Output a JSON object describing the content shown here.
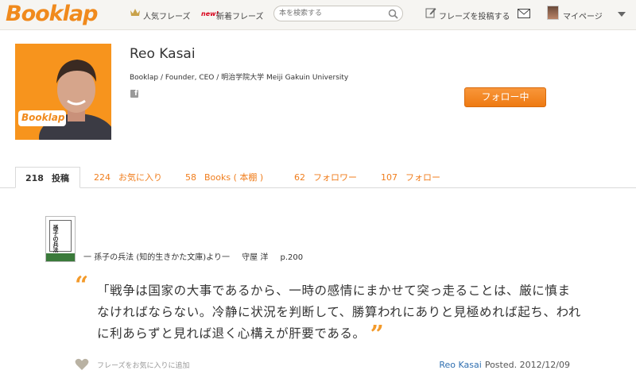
{
  "header": {
    "logo": "Booklap",
    "popular_label": "人気フレーズ",
    "new_badge": "new!",
    "new_label": "新着フレーズ",
    "search_placeholder": "本を検索する",
    "post_label": "フレーズを投稿する",
    "mypage_label": "マイページ"
  },
  "profile": {
    "name": "Reo Kasai",
    "bio": "Booklap / Founder, CEO / 明治学院大学 Meiji Gakuin University",
    "photo_badge": "Booklap",
    "follow_button": "フォロー中"
  },
  "tabs": [
    {
      "count": "218",
      "label": "投稿"
    },
    {
      "count": "224",
      "label": "お気に入り"
    },
    {
      "count": "58",
      "label": "Books ( 本棚 )"
    },
    {
      "count": "62",
      "label": "フォロワー"
    },
    {
      "count": "107",
      "label": "フォロー"
    }
  ],
  "post": {
    "book_cover_text": "孫子の兵法",
    "source_title": "一 孫子の兵法 (知的生きかた文庫)より一",
    "source_author": "守屋 洋",
    "source_page": "p.200",
    "quote": "「戦争は国家の大事であるから、一時の感情にまかせて突っ走ることは、厳に慎まなければならない。冷静に状況を判断して、勝算われにありと見極めれば起ち、われに利あらずと見れば退く心構えが肝要である。",
    "open_mark": "“",
    "close_mark": "”",
    "fav_label": "フレーズをお気に入りに追加",
    "author": "Reo Kasai",
    "posted": "Posted. 2012/12/09"
  },
  "colors": {
    "accent": "#f08a1d",
    "link": "#2f6fb0"
  }
}
